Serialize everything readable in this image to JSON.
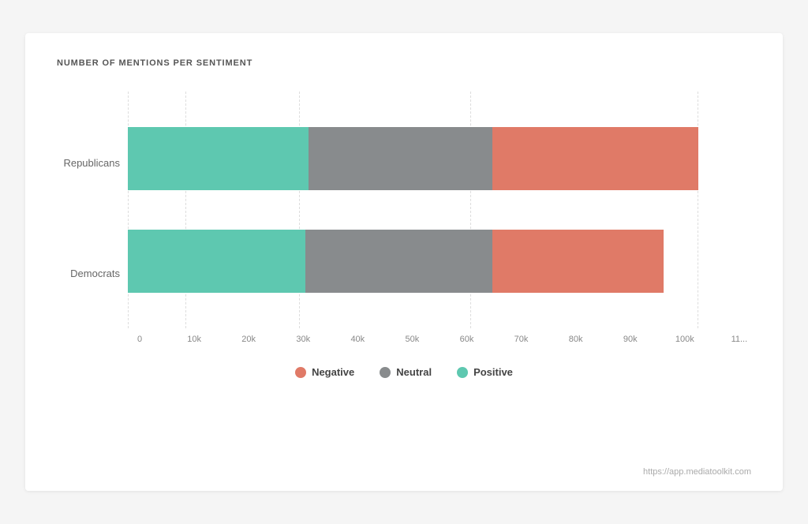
{
  "chart": {
    "title": "NUMBER OF MENTIONS PER SENTIMENT",
    "watermark": "https://app.mediatoolkit.com",
    "y_labels": [
      "Republicans",
      "Democrats"
    ],
    "x_labels": [
      "0",
      "10k",
      "20k",
      "30k",
      "40k",
      "50k",
      "60k",
      "70k",
      "80k",
      "90k",
      "100k",
      "11..."
    ],
    "bars": [
      {
        "label": "Republicans",
        "positive_pct": 31.5,
        "neutral_pct": 31.5,
        "negative_pct": 35.5
      },
      {
        "label": "Democrats",
        "positive_pct": 31.0,
        "neutral_pct": 32.0,
        "negative_pct": 29.5
      }
    ],
    "legend": [
      {
        "key": "negative",
        "label": "Negative",
        "color": "#e07a67"
      },
      {
        "key": "neutral",
        "label": "Neutral",
        "color": "#888b8d"
      },
      {
        "key": "positive",
        "label": "Positive",
        "color": "#5ec8b0"
      }
    ],
    "colors": {
      "positive": "#5ec8b0",
      "neutral": "#888b8d",
      "negative": "#e07a67",
      "grid": "#dddddd",
      "bg": "#ffffff"
    }
  }
}
